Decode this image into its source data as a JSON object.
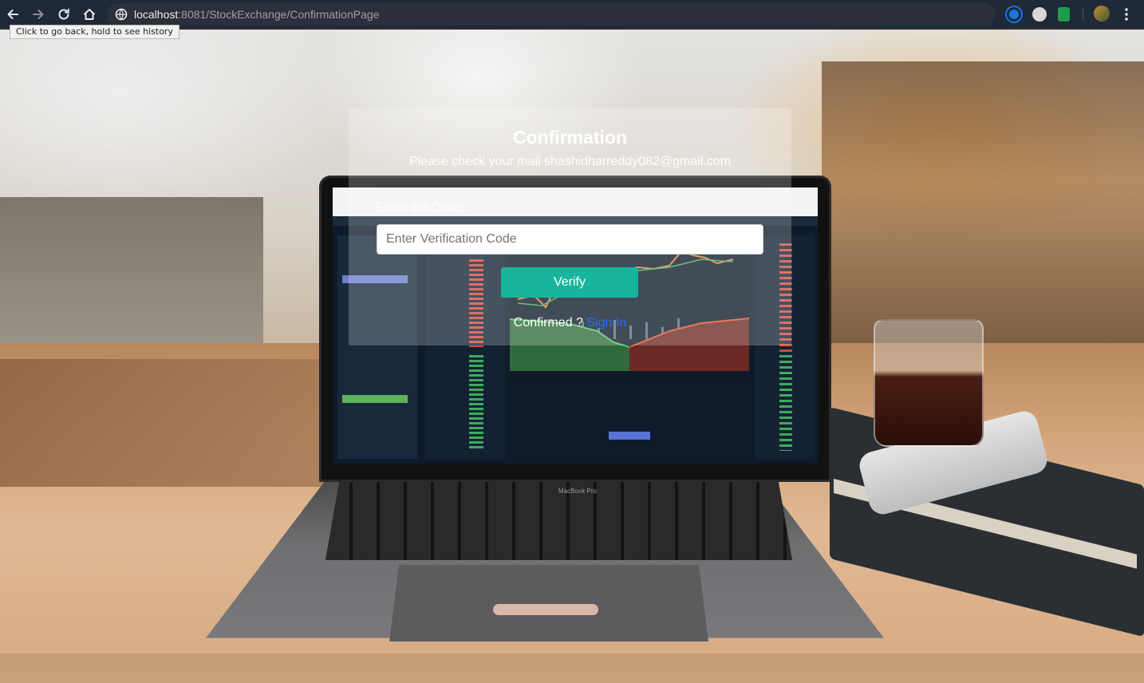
{
  "browser": {
    "url_host": "localhost",
    "url_path": ":8081/StockExchange/ConfirmationPage",
    "tooltip": "Click to go back, hold to see history"
  },
  "laptop": {
    "label": "MacBook Pro"
  },
  "card": {
    "title": "Confirmation",
    "subtitle": "Please check your mail shashidharreddy082@gmail.com",
    "code_label": "Enter the Code:",
    "code_placeholder": "Enter Verification Code",
    "code_value": "",
    "verify_label": "Verify",
    "confirmed_prompt": "Confirmed ?",
    "signin_label": "Sign In"
  },
  "colors": {
    "verify_button": "#18b59d",
    "signin_link": "#1e6fff",
    "chrome_bg": "#1f2937"
  }
}
